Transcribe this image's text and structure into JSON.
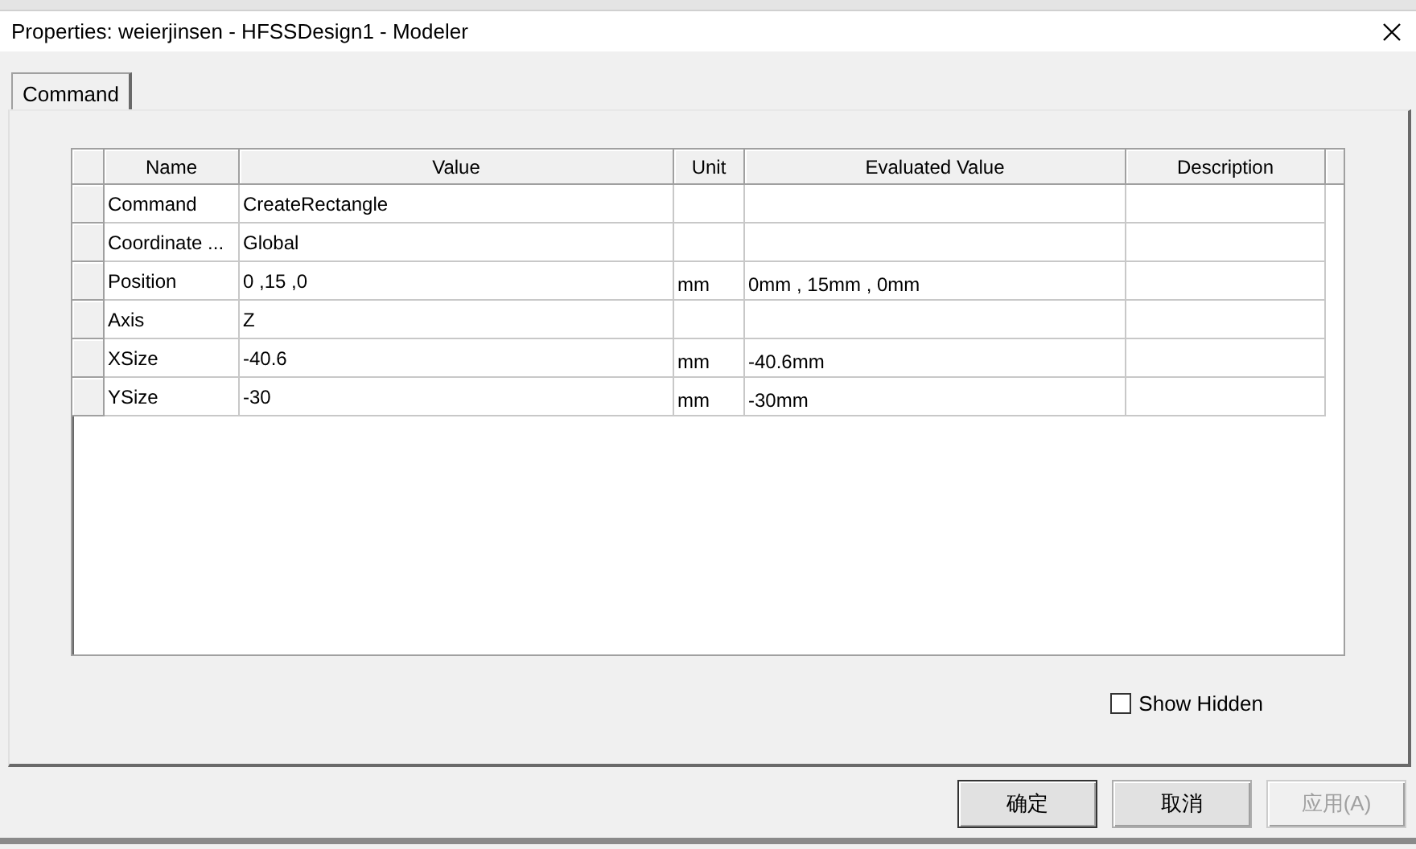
{
  "window": {
    "title": "Properties: weierjinsen - HFSSDesign1 - Modeler"
  },
  "tabs": [
    {
      "label": "Command",
      "selected": true
    }
  ],
  "table": {
    "columns": [
      "Name",
      "Value",
      "Unit",
      "Evaluated Value",
      "Description"
    ],
    "rows": [
      {
        "name": "Command",
        "value": "CreateRectangle"
      },
      {
        "name": "Coordinate ...",
        "value": "Global"
      },
      {
        "name": "Position",
        "value": "0 ,15 ,0",
        "unit": "mm",
        "evaluated_value": "0mm , 15mm , 0mm"
      },
      {
        "name": "Axis",
        "value": "Z"
      },
      {
        "name": "XSize",
        "value": "-40.6",
        "unit": "mm",
        "evaluated_value": "-40.6mm"
      },
      {
        "name": "YSize",
        "value": "-30",
        "unit": "mm",
        "evaluated_value": "-30mm"
      }
    ]
  },
  "show_hidden": {
    "label": "Show Hidden",
    "checked": false
  },
  "buttons": [
    {
      "label": "确定",
      "disabled": false
    },
    {
      "label": "取消",
      "disabled": false
    },
    {
      "label": "应用(A)",
      "disabled": true
    }
  ]
}
